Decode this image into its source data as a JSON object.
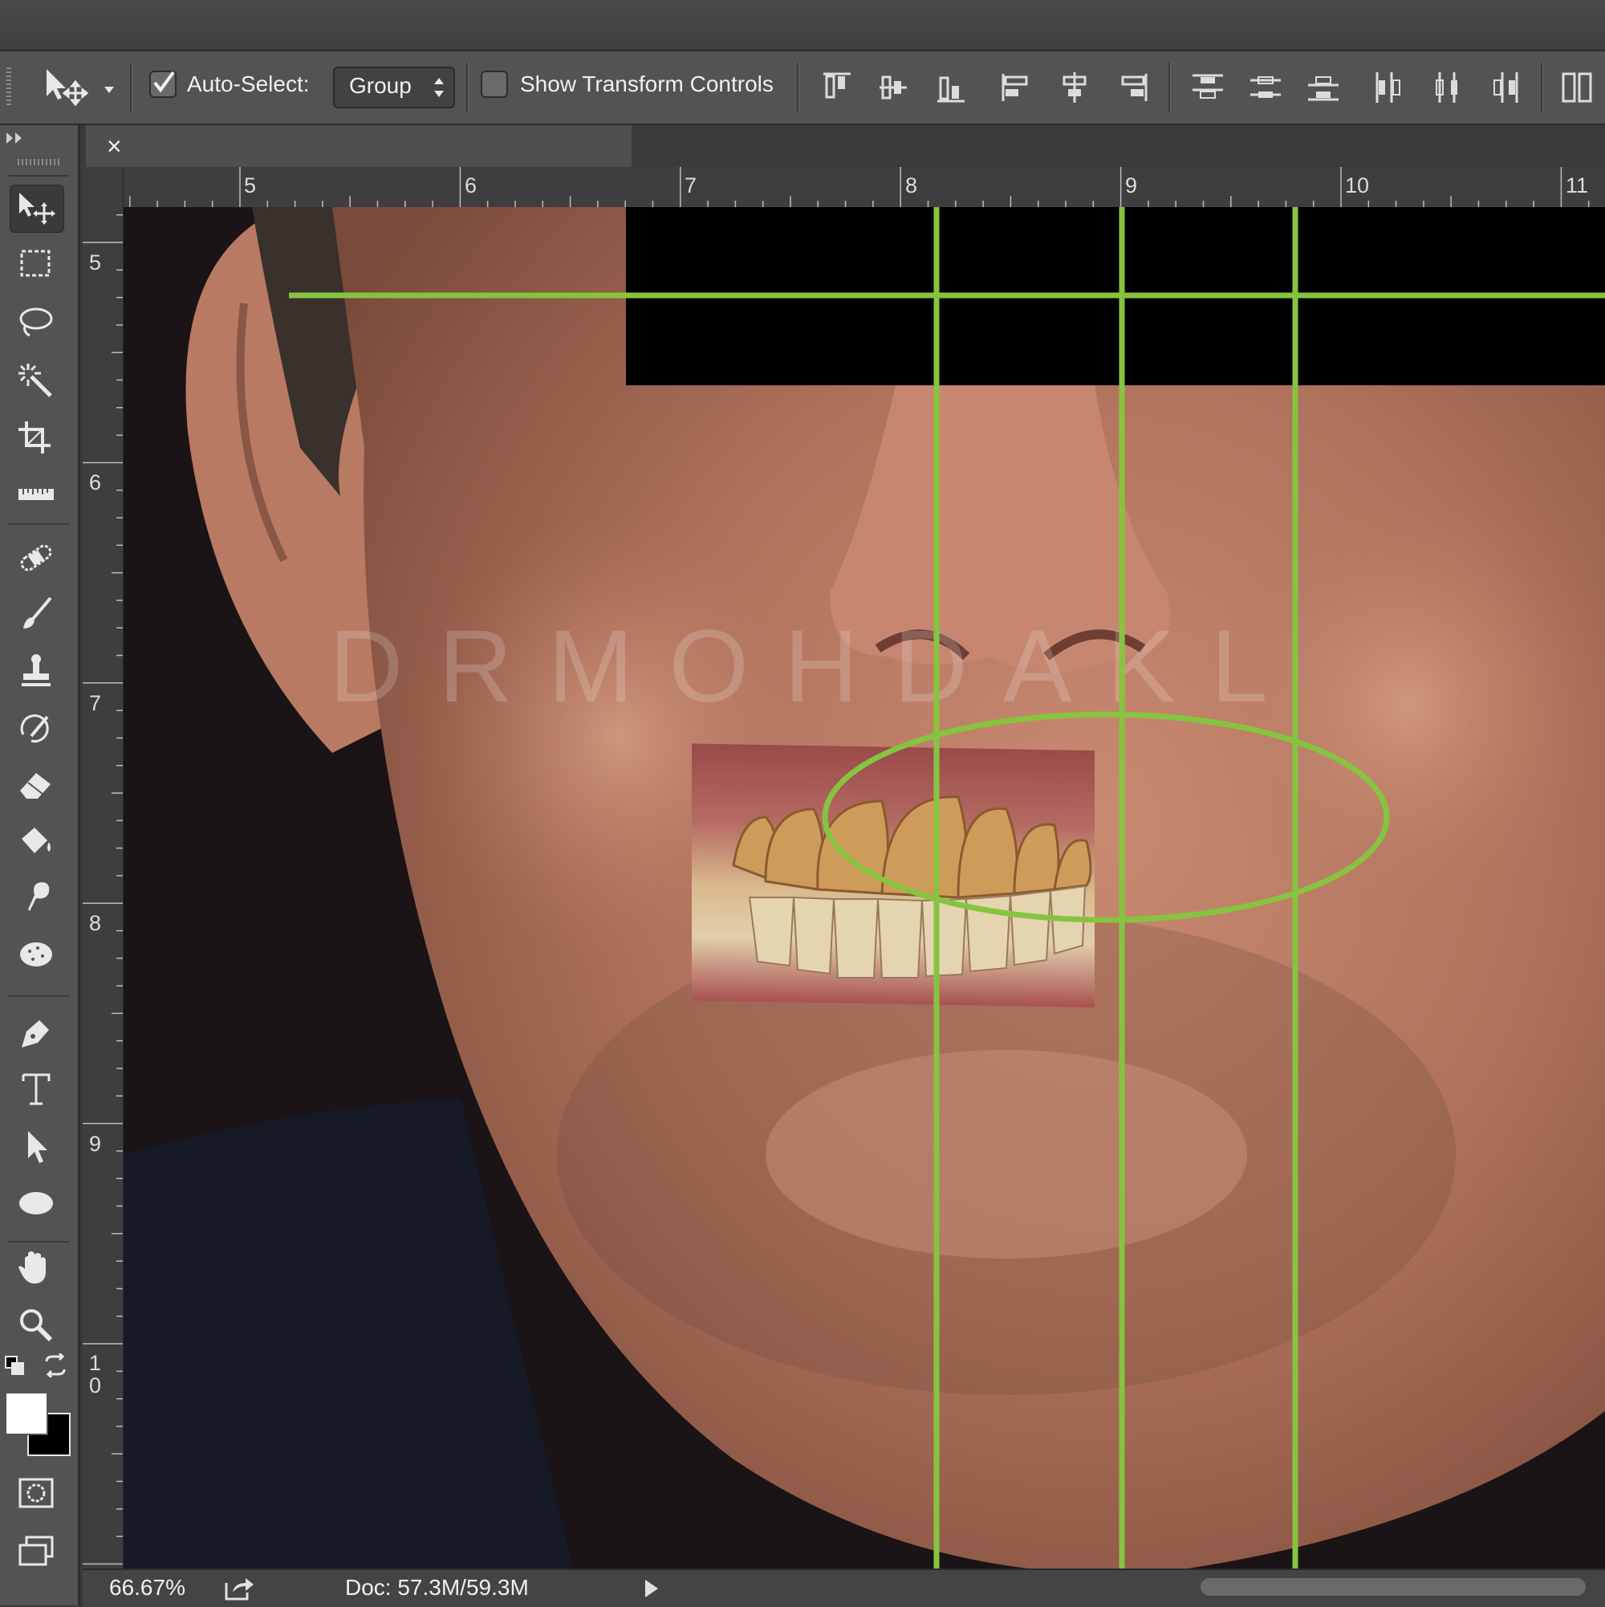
{
  "options_bar": {
    "auto_select_label": "Auto-Select:",
    "auto_select_checked": true,
    "auto_select_value": "Group",
    "show_transform_label": "Show Transform Controls",
    "show_transform_checked": false
  },
  "document": {
    "close_glyph": "×"
  },
  "ruler": {
    "top_labels": [
      "5",
      "6",
      "7",
      "8",
      "9",
      "10",
      "11"
    ],
    "left_labels": [
      "5",
      "6",
      "7",
      "8",
      "9",
      "1\n0"
    ]
  },
  "canvas": {
    "watermark": "DRMOHDAKL"
  },
  "status": {
    "zoom": "66.67%",
    "doc_size": "Doc: 57.3M/59.3M"
  },
  "tools": [
    "move-tool",
    "marquee-tool",
    "lasso-tool",
    "magic-wand-tool",
    "crop-tool",
    "ruler-tool",
    "healing-brush-tool",
    "brush-tool",
    "clone-stamp-tool",
    "history-brush-tool",
    "eraser-tool",
    "paint-bucket-tool",
    "smudge-tool",
    "sponge-tool",
    "pen-tool",
    "type-tool",
    "path-selection-tool",
    "ellipse-tool",
    "hand-tool",
    "zoom-tool"
  ],
  "colors": {
    "guide_green": "#86c440",
    "panel": "#535353",
    "foreground": "#ffffff",
    "background": "#000000"
  }
}
